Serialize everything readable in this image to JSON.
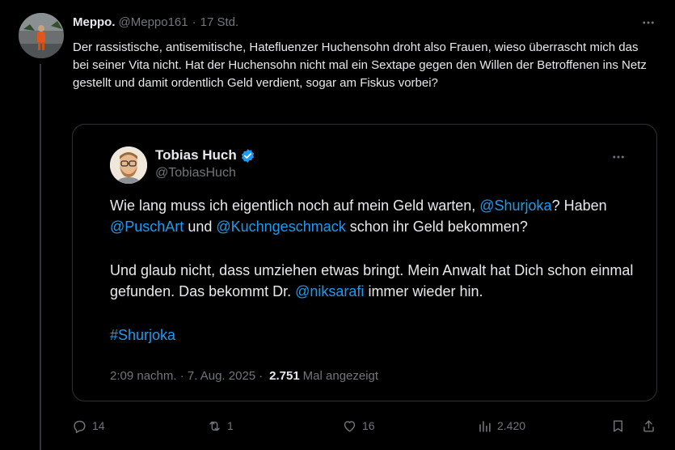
{
  "tweet": {
    "author_name": "Meppo.",
    "handle": "@Meppo161",
    "separator": "·",
    "time": "17 Std.",
    "text": "Der rassistische, antisemitische, Hatefluenzer Huchensohn droht also Frauen, wieso überrascht mich das bei seiner Vita nicht. Hat der Huchensohn nicht mal ein Sextape gegen den Willen der Betroffenen ins Netz gestellt und damit ordentlich Geld verdient, sogar am Fiskus vorbei?"
  },
  "quote": {
    "author_name": "Tobias Huch",
    "handle": "@TobiasHuch",
    "verified": true,
    "p1_a": "Wie lang muss ich eigentlich noch auf mein Geld warten, ",
    "p1_mention1": "@Shurjoka",
    "p1_b": "? Haben ",
    "p1_mention2": "@PuschArt",
    "p1_c": " und ",
    "p1_mention3": "@Kuchngeschmack",
    "p1_d": " schon ihr Geld bekommen?",
    "p2_a": "Und glaub nicht, dass umziehen etwas bringt. Mein Anwalt hat Dich schon einmal gefunden. Das bekommt Dr. ",
    "p2_mention": "@niksarafi",
    "p2_b": " immer wieder hin.",
    "hashtag": "#Shurjoka",
    "timestamp": "2:09 nachm. · 7. Aug. 2025",
    "dot": "·",
    "views_count": "2.751",
    "views_label": "Mal angezeigt"
  },
  "actions": {
    "replies": "14",
    "reposts": "1",
    "likes": "16",
    "views": "2.420"
  },
  "colors": {
    "background": "#000000",
    "text": "#e7e9ea",
    "muted": "#71767b",
    "link": "#1d9bf0",
    "border": "#2f3336"
  }
}
